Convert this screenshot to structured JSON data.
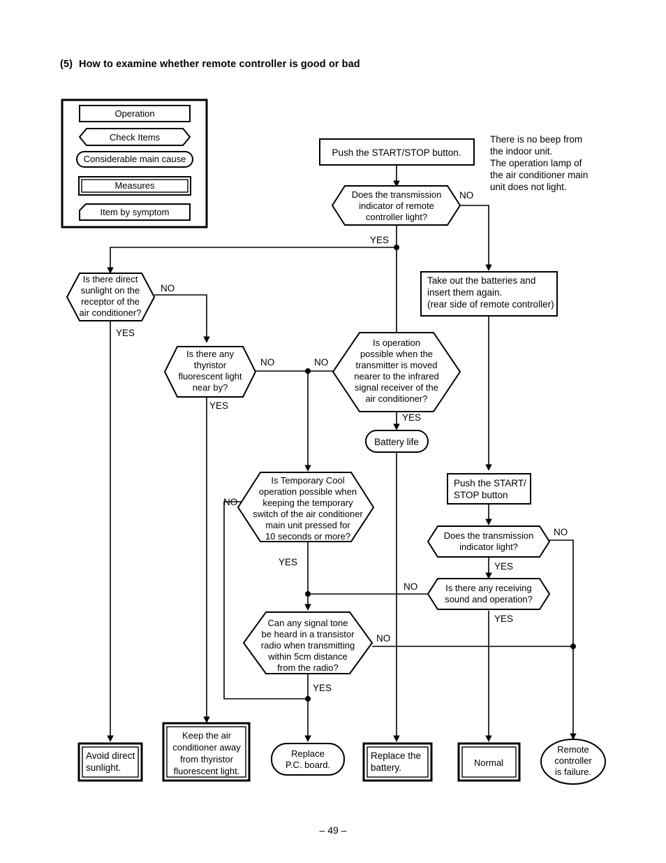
{
  "page": {
    "heading_number": "(5)",
    "heading_text": "How to examine whether remote controller is good or bad",
    "page_number": "– 49 –"
  },
  "legend": {
    "items": [
      {
        "label": "Operation",
        "shape": "rectangle"
      },
      {
        "label": "Check Items",
        "shape": "hexagon"
      },
      {
        "label": "Considerable main cause",
        "shape": "stadium"
      },
      {
        "label": "Measures",
        "shape": "double-rectangle"
      },
      {
        "label": "Item by symptom",
        "shape": "cut-corner-rectangle"
      }
    ]
  },
  "note": {
    "lines": [
      "There is no beep from",
      "the indoor unit.",
      "The operation lamp of",
      "the air conditioner main",
      "unit does not light."
    ]
  },
  "nodes": {
    "push_start_stop_1": {
      "lines": [
        "Push the START/STOP button."
      ]
    },
    "transmission_indicator_remote": {
      "lines": [
        "Does the transmission",
        "indicator of remote",
        "controller light?"
      ]
    },
    "take_out_batteries": {
      "lines": [
        "Take out the batteries and",
        "insert them again.",
        "(rear side of remote controller)"
      ]
    },
    "direct_sunlight": {
      "lines": [
        "Is there direct",
        "sunlight on the",
        "receptor of the",
        "air conditioner?"
      ]
    },
    "thyristor_light": {
      "lines": [
        "Is there any",
        "thyristor",
        "fluorescent light",
        "near by?"
      ]
    },
    "operation_possible_nearer": {
      "lines": [
        "Is operation",
        "possible when the",
        "transmitter is moved",
        "nearer to the infrared",
        "signal receiver of the",
        "air conditioner?"
      ]
    },
    "battery_life": {
      "lines": [
        "Battery life"
      ]
    },
    "temporary_cool": {
      "lines": [
        "Is Temporary Cool",
        "operation possible when",
        "keeping the temporary",
        "switch of the air conditioner",
        "main unit pressed for",
        "10 seconds or more?"
      ]
    },
    "push_start_stop_2": {
      "lines": [
        "Push the START/",
        "STOP button"
      ]
    },
    "transmission_indicator_light": {
      "lines": [
        "Does the transmission",
        "indicator light?"
      ]
    },
    "receiving_sound": {
      "lines": [
        "Is there any receiving",
        "sound and operation?"
      ]
    },
    "signal_tone_radio": {
      "lines": [
        "Can any signal tone",
        "be heard in a transistor",
        "radio when transmitting",
        "within 5cm distance",
        "from the radio?"
      ]
    },
    "avoid_direct_sunlight": {
      "lines": [
        "Avoid direct",
        "sunlight."
      ]
    },
    "keep_away_thyristor": {
      "lines": [
        "Keep the air",
        "conditioner away",
        "from thyristor",
        "fluorescent light."
      ]
    },
    "replace_pc_board": {
      "lines": [
        "Replace",
        "P.C. board."
      ]
    },
    "replace_battery": {
      "lines": [
        "Replace the",
        "battery."
      ]
    },
    "normal": {
      "lines": [
        "Normal"
      ]
    },
    "remote_controller_failure": {
      "lines": [
        "Remote",
        "controller",
        "is failure."
      ]
    }
  },
  "edge_labels": {
    "yes": "YES",
    "no": "NO"
  },
  "colors": {
    "stroke": "#000000",
    "fill": "#ffffff",
    "background": "#ffffff"
  }
}
